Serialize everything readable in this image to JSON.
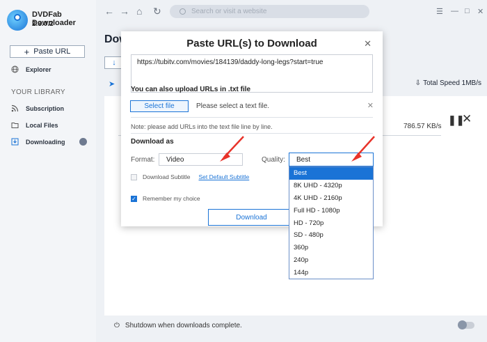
{
  "app": {
    "name": "DVDFab Downloader",
    "version": "2.3.0.2"
  },
  "sidebar": {
    "paste_url": "Paste URL",
    "explorer": "Explorer",
    "library_title": "YOUR LIBRARY",
    "items": [
      {
        "label": "Subscription",
        "icon": "rss-icon"
      },
      {
        "label": "Local Files",
        "icon": "folder-icon"
      },
      {
        "label": "Downloading",
        "icon": "download-icon"
      }
    ]
  },
  "topbar": {
    "search_placeholder": "Search or visit a website"
  },
  "main": {
    "title": "Dow",
    "total_speed": "Total Speed 1MB/s",
    "speed_value": "786.57 KB/s",
    "shutdown_label": "Shutdown when downloads complete."
  },
  "dialog": {
    "title": "Paste URL(s) to Download",
    "url": "https://tubitv.com/movies/184139/daddy-long-legs?start=true",
    "upload_title": "You can also upload URLs in .txt file",
    "select_file": "Select file",
    "select_hint": "Please select a text file.",
    "note": "Note: please add URLs into the text file line by line.",
    "download_as": "Download as",
    "format_label": "Format:",
    "format_value": "Video",
    "quality_label": "Quality:",
    "quality_value": "Best",
    "subtitle_label": "Download Subtitle",
    "subtitle_link": "Set Default Subtitle",
    "remember_label": "Remember my choice",
    "download_button": "Download"
  },
  "quality_options": [
    "Best",
    "8K UHD - 4320p",
    "4K UHD - 2160p",
    "Full HD - 1080p",
    "HD - 720p",
    "SD - 480p",
    "360p",
    "240p",
    "144p"
  ],
  "colors": {
    "accent": "#1a73d6",
    "arrow": "#e8332a"
  }
}
